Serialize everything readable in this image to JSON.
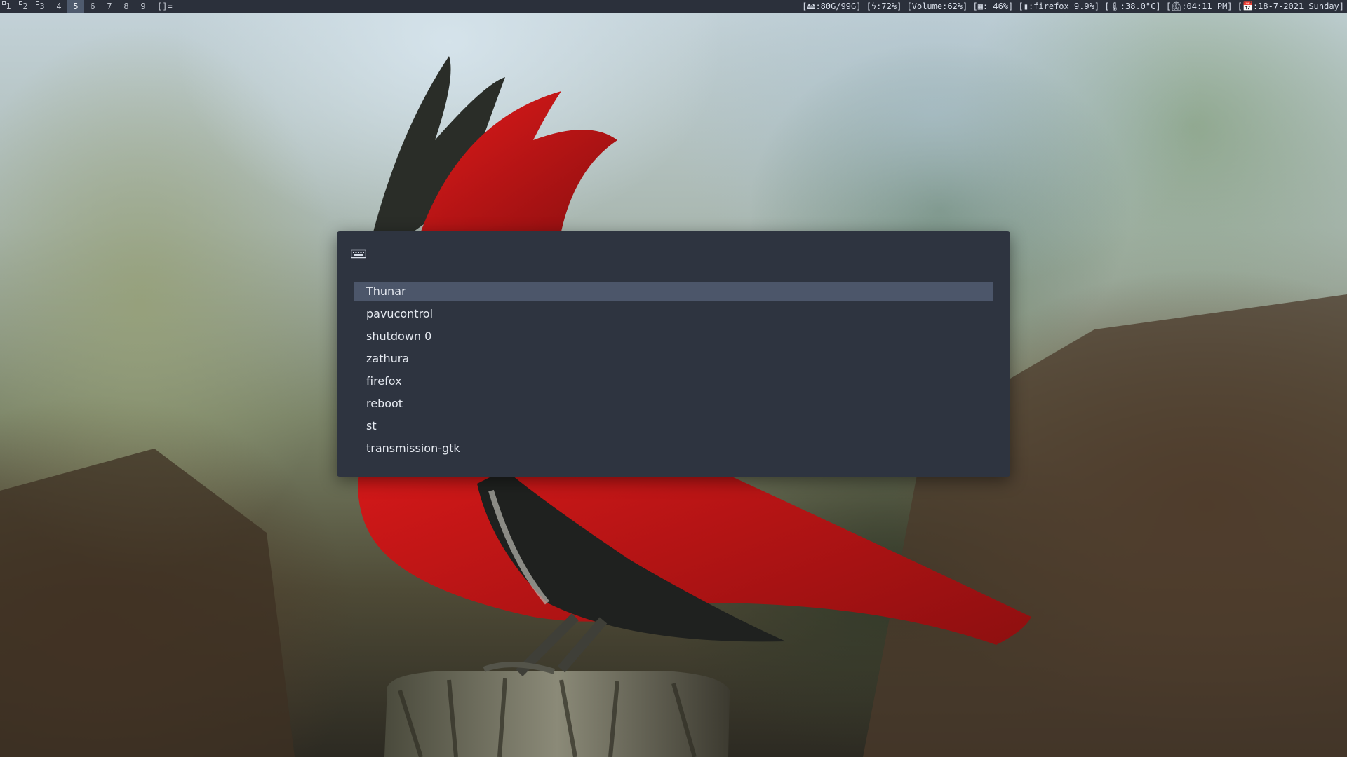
{
  "topbar": {
    "tags": [
      {
        "label": "1",
        "occupied": true,
        "selected": false
      },
      {
        "label": "2",
        "occupied": true,
        "selected": false
      },
      {
        "label": "3",
        "occupied": true,
        "selected": false
      },
      {
        "label": "4",
        "occupied": false,
        "selected": false
      },
      {
        "label": "5",
        "occupied": false,
        "selected": true
      },
      {
        "label": "6",
        "occupied": false,
        "selected": false
      },
      {
        "label": "7",
        "occupied": false,
        "selected": false
      },
      {
        "label": "8",
        "occupied": false,
        "selected": false
      },
      {
        "label": "9",
        "occupied": false,
        "selected": false
      }
    ],
    "layout_symbol": "[]=",
    "status": {
      "disk": "[🖴:80G/99G]",
      "battery": "[ϟ:72%]",
      "volume": "[Volume:62%]",
      "memory": "[▦: 46%]",
      "cpu": "[▮:firefox 9.9%]",
      "temperature": "[🌡:38.0°C]",
      "time": "[⏲:04:11 PM]",
      "date": "[📅:18-7-2021 Sunday]"
    }
  },
  "launcher": {
    "icon": "keyboard-icon",
    "input_value": "",
    "items": [
      "Thunar",
      "pavucontrol",
      "shutdown 0",
      "zathura",
      "firefox",
      "reboot",
      "st",
      "transmission-gtk"
    ],
    "selected_index": 0
  },
  "colors": {
    "bar_bg": "#2b303b",
    "bar_selected_tag": "#4f5b6e",
    "launcher_bg": "#2e3440",
    "launcher_selected": "#4c566a",
    "launcher_text": "#e5e9f0"
  },
  "wallpaper": {
    "subject": "red-cardinal-bird-on-post"
  }
}
